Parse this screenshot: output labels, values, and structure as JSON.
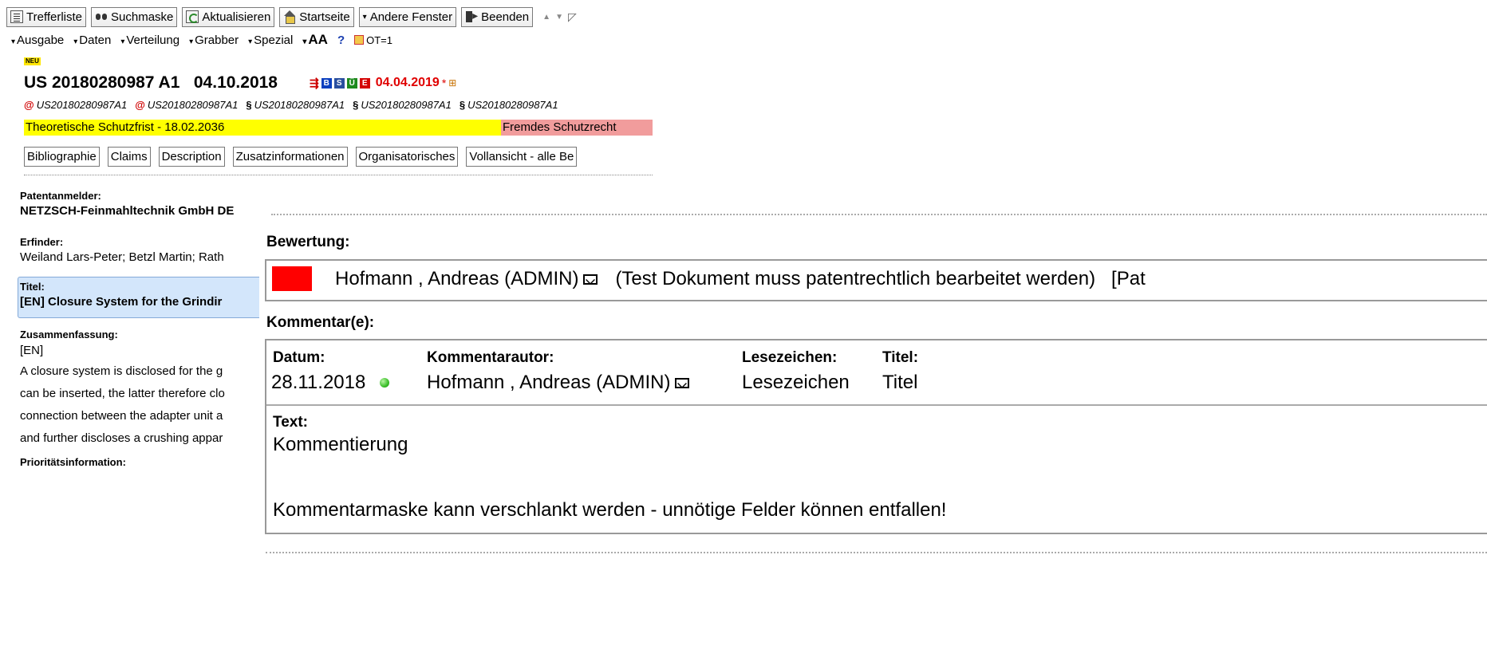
{
  "toolbar": {
    "buttons": [
      {
        "label": "Trefferliste",
        "icon": "list-icon"
      },
      {
        "label": "Suchmaske",
        "icon": "binoculars-icon"
      },
      {
        "label": "Aktualisieren",
        "icon": "refresh-icon"
      },
      {
        "label": "Startseite",
        "icon": "home-icon"
      },
      {
        "label": "Andere Fenster",
        "icon": "dropdown-caret"
      },
      {
        "label": "Beenden",
        "icon": "exit-icon"
      }
    ]
  },
  "menu": {
    "items": [
      "Ausgabe",
      "Daten",
      "Verteilung",
      "Grabber",
      "Spezial",
      "AA"
    ],
    "help": "?",
    "ot": "OT=1"
  },
  "document": {
    "new_badge": "NEU",
    "title": "US 20180280987 A1   04.10.2018",
    "badges": [
      {
        "letter": "B",
        "color": "#0b3fbf"
      },
      {
        "letter": "S",
        "color": "#2a4f9f"
      },
      {
        "letter": "Ü",
        "color": "#1e8a1e"
      },
      {
        "letter": "E",
        "color": "#d40000"
      }
    ],
    "priority_date": "04.04.2019",
    "asterisk": "*",
    "links": [
      {
        "symbol": "@",
        "text": "US20180280987A1"
      },
      {
        "symbol": "@",
        "text": "US20180280987A1"
      },
      {
        "symbol": "§",
        "text": "US20180280987A1"
      },
      {
        "symbol": "§",
        "text": "US20180280987A1"
      },
      {
        "symbol": "§",
        "text": "US20180280987A1"
      }
    ],
    "protection_term": "Theoretische Schutzfrist - 18.02.2036",
    "foreign_right": "Fremdes Schutzrecht",
    "tabs": [
      "Bibliographie",
      "Claims",
      "Description",
      "Zusatzinformationen",
      "Organisatorisches",
      "Vollansicht - alle Be"
    ],
    "applicant_label": "Patentanmelder:",
    "applicant": "NETZSCH-Feinmahltechnik GmbH DE",
    "inventor_label": "Erfinder:",
    "inventors": "Weiland Lars-Peter; Betzl Martin; Rath",
    "title_label": "Titel:",
    "title_value": "[EN] Closure System for the Grindir",
    "summary_label": "Zusammenfassung:",
    "summary_lang": "[EN]",
    "summary_lines": [
      "A closure system is disclosed for the g",
      "can be inserted, the latter therefore clo",
      "connection between the adapter unit a",
      "and further discloses a crushing appar"
    ],
    "priority_label": "Prioritätsinformation:"
  },
  "popup": {
    "rating_label": "Bewertung:",
    "rating_color": "#ff0000",
    "rating_author": "Hofmann , Andreas (ADMIN)",
    "rating_text": "(Test Dokument muss patentrechtlich bearbeitet werden)   [Pat",
    "comments_label": "Kommentar(e):",
    "headers": {
      "date": "Datum:",
      "author": "Kommentarautor:",
      "bookmark": "Lesezeichen:",
      "title": "Titel:"
    },
    "comment": {
      "date": "28.11.2018",
      "author": "Hofmann , Andreas (ADMIN)",
      "bookmark": "Lesezeichen",
      "title": "Titel",
      "text_label": "Text:",
      "text_line1": "Kommentierung",
      "text_line2": "Kommentarmaske kann verschlankt werden - unnötige Felder können entfallen!"
    }
  }
}
